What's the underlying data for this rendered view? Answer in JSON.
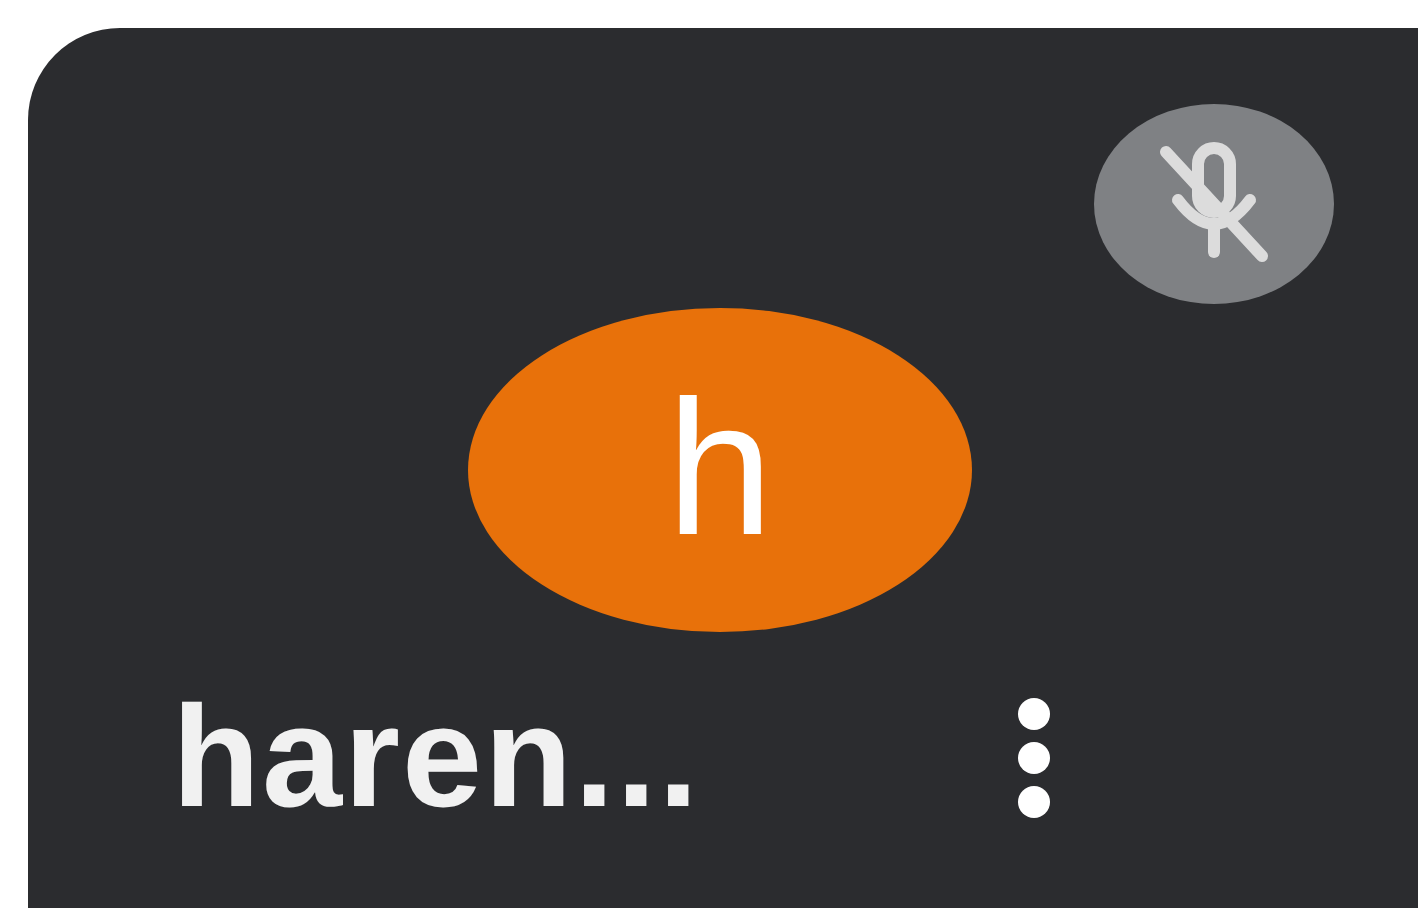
{
  "participant": {
    "initial": "h",
    "name": "haren...",
    "muted": true
  }
}
